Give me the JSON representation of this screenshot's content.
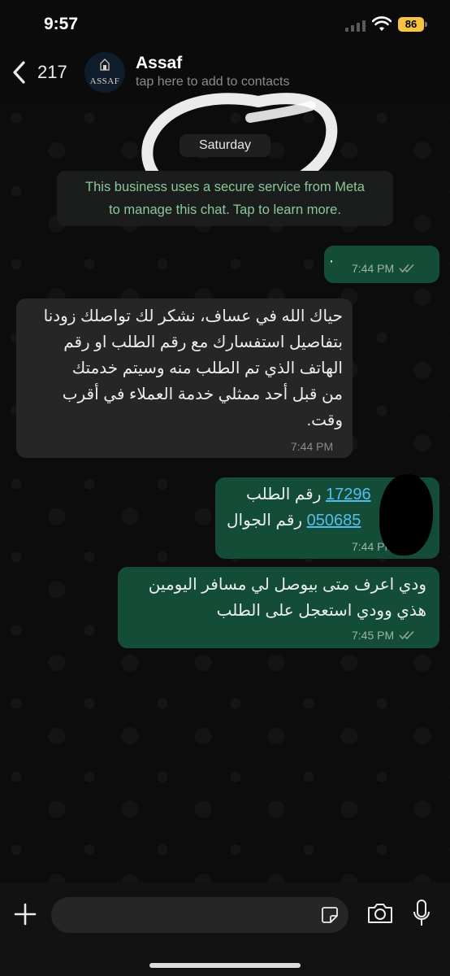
{
  "status_bar": {
    "time": "9:57",
    "battery": "86"
  },
  "header": {
    "back_count": "217",
    "contact_name": "Assaf",
    "contact_subtitle": "tap here to add to contacts",
    "avatar_text": "ASSAF"
  },
  "chat": {
    "date_label": "Saturday",
    "notice_line1": "This business uses a secure service from Meta",
    "notice_line2": "to manage this chat. Tap to learn more.",
    "messages": [
      {
        "direction": "out",
        "text": "·",
        "time": "7:44 PM",
        "read": true
      },
      {
        "direction": "in",
        "lines": [
          "حياك الله في عساف، نشكر لك تواصلك زودنا",
          "بتفاصيل استفسارك مع رقم الطلب او رقم",
          "الهاتف الذي تم الطلب منه وسيتم خدمتك",
          "من قبل أحد ممثلي خدمة العملاء في أقرب",
          "وقت."
        ],
        "time": "7:44 PM"
      },
      {
        "direction": "out",
        "line1_label": "رقم الطلب",
        "line1_number": "17296",
        "line2_label": "رقم الجوال",
        "line2_number": "050685",
        "time": "7:44 PM",
        "read": true
      },
      {
        "direction": "out",
        "lines": [
          "ودي اعرف متى بيوصل لي مسافر اليومين",
          "هذي وودي استعجل على الطلب"
        ],
        "time": "7:45 PM",
        "read": true
      }
    ]
  },
  "composer": {
    "placeholder": "",
    "value": ""
  },
  "colors": {
    "outgoing_bubble": "#144d37",
    "incoming_bubble": "#262626",
    "notice_text": "#8bc79a",
    "link": "#53bdeb",
    "battery": "#f6c342"
  }
}
